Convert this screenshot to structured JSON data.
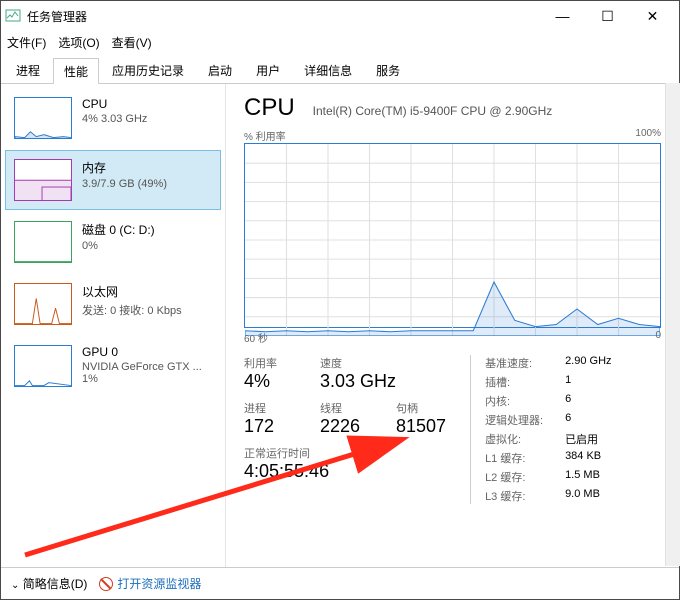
{
  "window": {
    "title": "任务管理器"
  },
  "window_controls": {
    "min": "—",
    "max": "☐",
    "close": "✕"
  },
  "menu": {
    "file": "文件(F)",
    "options": "选项(O)",
    "view": "查看(V)"
  },
  "tabs": {
    "processes": "进程",
    "performance": "性能",
    "app_history": "应用历史记录",
    "startup": "启动",
    "users": "用户",
    "details": "详细信息",
    "services": "服务"
  },
  "sidebar": [
    {
      "name": "CPU",
      "value": "4% 3.03 GHz",
      "color": "#2b7cd3"
    },
    {
      "name": "内存",
      "value": "3.9/7.9 GB (49%)",
      "color": "#a43bb1"
    },
    {
      "name": "磁盘 0 (C: D:)",
      "value": "0%",
      "color": "#3aa35f"
    },
    {
      "name": "以太网",
      "value": "发送: 0 接收: 0 Kbps",
      "color": "#c85a1a"
    },
    {
      "name": "GPU 0",
      "value": "NVIDIA GeForce GTX ... 1%",
      "color": "#2b7cd3"
    }
  ],
  "main": {
    "title": "CPU",
    "subtitle": "Intel(R) Core(TM) i5-9400F CPU @ 2.90GHz",
    "chart_top_left": "% 利用率",
    "chart_top_right": "100%",
    "chart_bottom_left": "60 秒",
    "chart_bottom_right": "0",
    "stats_left": {
      "row1": [
        {
          "label": "利用率",
          "value": "4%"
        },
        {
          "label": "速度",
          "value": "3.03 GHz"
        }
      ],
      "row2": [
        {
          "label": "进程",
          "value": "172"
        },
        {
          "label": "线程",
          "value": "2226"
        },
        {
          "label": "句柄",
          "value": "81507"
        }
      ],
      "uptime_label": "正常运行时间",
      "uptime_value": "4:05:55:46"
    },
    "stats_right": [
      {
        "key": "基准速度:",
        "val": "2.90 GHz"
      },
      {
        "key": "插槽:",
        "val": "1"
      },
      {
        "key": "内核:",
        "val": "6"
      },
      {
        "key": "逻辑处理器:",
        "val": "6"
      },
      {
        "key": "虚拟化:",
        "val": "已启用"
      },
      {
        "key": "L1 缓存:",
        "val": "384 KB"
      },
      {
        "key": "L2 缓存:",
        "val": "1.5 MB"
      },
      {
        "key": "L3 缓存:",
        "val": "9.0 MB"
      }
    ]
  },
  "statusbar": {
    "fewer_details": "简略信息(D)",
    "resource_monitor": "打开资源监视器"
  },
  "chart_data": {
    "type": "line",
    "title": "% 利用率",
    "xlabel": "60 秒 → 0",
    "ylabel": "% 利用率",
    "ylim": [
      0,
      100
    ],
    "x_seconds_ago": [
      60,
      57,
      54,
      51,
      48,
      45,
      42,
      39,
      36,
      33,
      30,
      27,
      24,
      21,
      18,
      15,
      12,
      9,
      6,
      3,
      0
    ],
    "values": [
      3,
      2,
      3,
      2,
      3,
      2,
      3,
      2,
      3,
      3,
      3,
      3,
      28,
      8,
      5,
      6,
      14,
      6,
      9,
      6,
      5
    ]
  }
}
